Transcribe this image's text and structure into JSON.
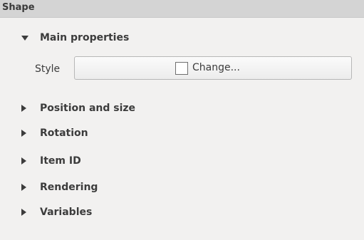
{
  "panel": {
    "title": "Shape"
  },
  "main_properties": {
    "label": "Main properties",
    "style_label": "Style",
    "change_button_label": "Change...",
    "swatch_color": "#ffffff"
  },
  "groups": [
    {
      "label": "Position and size"
    },
    {
      "label": "Rotation"
    },
    {
      "label": "Item ID"
    },
    {
      "label": "Rendering"
    },
    {
      "label": "Variables"
    }
  ]
}
